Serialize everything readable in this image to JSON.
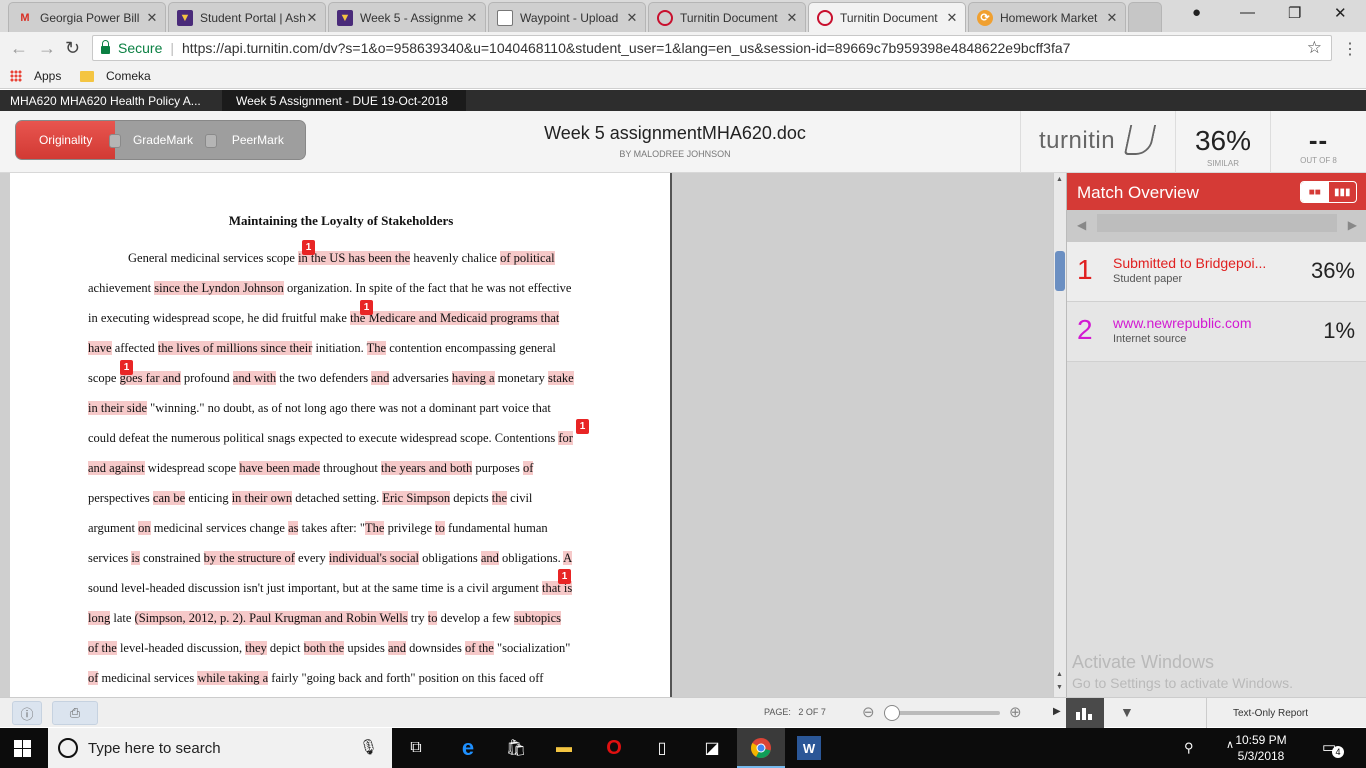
{
  "browser": {
    "tabs": [
      {
        "title": "Georgia Power Bill",
        "icon": "gmail-icon"
      },
      {
        "title": "Student Portal | Ash",
        "icon": "shield-icon"
      },
      {
        "title": "Week 5 - Assignme",
        "icon": "shield-icon"
      },
      {
        "title": "Waypoint - Upload",
        "icon": "page-icon"
      },
      {
        "title": "Turnitin Document",
        "icon": "turnitin-icon"
      },
      {
        "title": "Turnitin Document",
        "icon": "turnitin-icon"
      },
      {
        "title": "Homework Market",
        "icon": "hm-icon"
      }
    ],
    "secure_label": "Secure",
    "url": "https://api.turnitin.com/dv?s=1&o=958639340&u=1040468110&student_user=1&lang=en_us&session-id=89669c7b959398e4848622e9bcff3fa7",
    "bookmarks": [
      "Apps",
      "Comeka"
    ]
  },
  "turnitin": {
    "course": "MHA620 MHA620 Health Policy A...",
    "assignment": "Week 5 Assignment - DUE 19-Oct-2018",
    "modes": [
      "Originality",
      "GradeMark",
      "PeerMark"
    ],
    "doc_title": "Week 5 assignmentMHA620.doc",
    "doc_author": "BY MALODREE JOHNSON",
    "brand": "turnitin",
    "similarity": "36%",
    "similarity_label": "SIMILAR",
    "out_of": "--",
    "out_of_label": "OUT OF 8"
  },
  "document": {
    "heading": "Maintaining the Loyalty of Stakeholders",
    "marker": "1",
    "lines": [
      [
        [
          "General medicinal services scope ",
          0
        ],
        [
          "in the US has been the",
          1
        ],
        [
          " heavenly chalice ",
          0
        ],
        [
          "of political",
          1
        ]
      ],
      [
        [
          "achievement ",
          0
        ],
        [
          "since the Lyndon Johnson",
          1
        ],
        [
          " organization. In spite of the fact that he was not effective",
          0
        ]
      ],
      [
        [
          "in executing widespread scope, he did fruitful make ",
          0
        ],
        [
          "the Medicare and Medicaid programs that",
          1
        ]
      ],
      [
        [
          "have",
          1
        ],
        [
          " affected ",
          0
        ],
        [
          "the lives of millions since their",
          1
        ],
        [
          " initiation. ",
          0
        ],
        [
          "The",
          1
        ],
        [
          " contention encompassing general",
          0
        ]
      ],
      [
        [
          "scope ",
          0
        ],
        [
          "goes far and",
          1
        ],
        [
          " profound ",
          0
        ],
        [
          "and with",
          1
        ],
        [
          " the two defenders ",
          0
        ],
        [
          "and",
          1
        ],
        [
          " adversaries ",
          0
        ],
        [
          "having a",
          1
        ],
        [
          " monetary ",
          0
        ],
        [
          "stake",
          1
        ]
      ],
      [
        [
          "in their side",
          1
        ],
        [
          " \"winning.\" no doubt, as of not long ago there was not a dominant part voice that",
          0
        ]
      ],
      [
        [
          "could defeat the numerous political snags expected to execute widespread scope. Contentions ",
          0
        ],
        [
          "for",
          1
        ]
      ],
      [
        [
          "and against",
          1
        ],
        [
          " widespread scope ",
          0
        ],
        [
          "have been made",
          1
        ],
        [
          " throughout ",
          0
        ],
        [
          "the years and both",
          1
        ],
        [
          " purposes ",
          0
        ],
        [
          "of",
          1
        ]
      ],
      [
        [
          "perspectives ",
          0
        ],
        [
          "can be",
          1
        ],
        [
          " enticing ",
          0
        ],
        [
          "in their own",
          1
        ],
        [
          " detached setting. ",
          0
        ],
        [
          "Eric Simpson",
          1
        ],
        [
          " depicts ",
          0
        ],
        [
          "the",
          1
        ],
        [
          " civil",
          0
        ]
      ],
      [
        [
          "argument ",
          0
        ],
        [
          "on",
          1
        ],
        [
          " medicinal services change ",
          0
        ],
        [
          "as",
          1
        ],
        [
          " takes after: \"",
          0
        ],
        [
          "The",
          1
        ],
        [
          " privilege ",
          0
        ],
        [
          "to",
          1
        ],
        [
          " fundamental human",
          0
        ]
      ],
      [
        [
          "services ",
          0
        ],
        [
          "is",
          1
        ],
        [
          " constrained ",
          0
        ],
        [
          "by the structure of",
          1
        ],
        [
          " every ",
          0
        ],
        [
          "individual's social",
          1
        ],
        [
          " obligations ",
          0
        ],
        [
          "and",
          1
        ],
        [
          " obligations. ",
          0
        ],
        [
          "A",
          1
        ]
      ],
      [
        [
          "sound level-headed discussion isn't just important, but at the same time is a civil argument ",
          0
        ],
        [
          "that is",
          1
        ]
      ],
      [
        [
          "long",
          1
        ],
        [
          " late ",
          0
        ],
        [
          "(Simpson, 2012, p. 2). Paul Krugman and Robin Wells",
          1
        ],
        [
          " try ",
          0
        ],
        [
          "to",
          1
        ],
        [
          " develop a few ",
          0
        ],
        [
          "subtopics",
          1
        ]
      ],
      [
        [
          "of the",
          1
        ],
        [
          " level-headed discussion, ",
          0
        ],
        [
          "they",
          1
        ],
        [
          " depict ",
          0
        ],
        [
          "both the",
          1
        ],
        [
          " upsides ",
          0
        ],
        [
          "and",
          1
        ],
        [
          " downsides ",
          0
        ],
        [
          "of the",
          1
        ],
        [
          " \"socialization\"",
          0
        ]
      ],
      [
        [
          "of",
          1
        ],
        [
          " medicinal services ",
          0
        ],
        [
          "while taking a",
          1
        ],
        [
          " fairly \"going back and forth\" position on this faced off",
          0
        ]
      ]
    ]
  },
  "match_overview": {
    "title": "Match Overview",
    "matches": [
      {
        "num": "1",
        "source": "Submitted to Bridgepoi...",
        "type": "Student paper",
        "percent": "36%",
        "color": "#e02020"
      },
      {
        "num": "2",
        "source": "www.newrepublic.com",
        "type": "Internet source",
        "percent": "1%",
        "color": "#d21ad2"
      }
    ],
    "watermark_line1": "Activate Windows",
    "watermark_line2": "Go to Settings to activate Windows."
  },
  "bottom": {
    "page_label": "PAGE:",
    "page_value": "2 OF 7",
    "text_only": "Text-Only Report"
  },
  "taskbar": {
    "search_placeholder": "Type here to search",
    "time": "10:59 PM",
    "date": "5/3/2018",
    "notification_count": "4"
  },
  "colors": {
    "highlight": "#f6c9c9",
    "accent_red": "#d53a36",
    "secure_green": "#0b8043"
  }
}
